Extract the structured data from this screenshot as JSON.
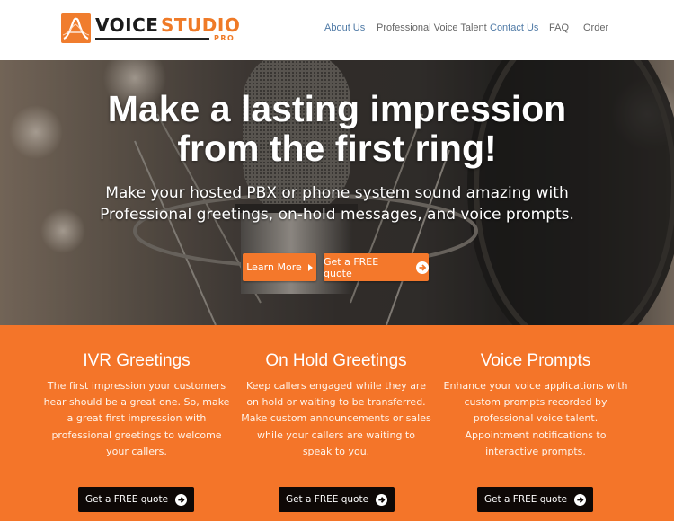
{
  "header": {
    "logo": {
      "word1": "VOICE",
      "word2": "STUDIO",
      "tagline": "PRO",
      "icon": "waveform-a-logo-icon"
    },
    "nav": [
      {
        "label": "About Us",
        "active": true
      },
      {
        "label": "Professional Voice Talent",
        "active": false
      },
      {
        "label": "Contact Us",
        "active": true
      },
      {
        "label": "FAQ",
        "active": false
      },
      {
        "label": "Order",
        "active": false
      }
    ]
  },
  "hero": {
    "title_line1": "Make a lasting impression",
    "title_line2": "from the first ring!",
    "subtitle_line1": "Make your hosted PBX or phone system sound amazing with",
    "subtitle_line2": "Professional greetings, on-hold messages, and voice prompts.",
    "buttons": [
      {
        "label": "Learn More",
        "icon": "caret-right-icon"
      },
      {
        "label": "Get a FREE quote",
        "icon": "arrow-circle-right-icon"
      }
    ],
    "background": "studio-microphone-photo"
  },
  "features": [
    {
      "title": "IVR Greetings",
      "lines": [
        "The first impression your customers",
        "hear should be a great one. So, make",
        "a great first impression with",
        "professional greetings to welcome",
        "your callers."
      ],
      "button": "Get a FREE quote"
    },
    {
      "title": "On Hold Greetings",
      "lines": [
        "Keep callers engaged while they are",
        "on hold or waiting to be transferred.",
        "Make custom announcements or sales",
        "while your callers are waiting to",
        "speak to you."
      ],
      "button": "Get a FREE quote"
    },
    {
      "title": "Voice Prompts",
      "lines": [
        "Enhance your voice applications with",
        "custom prompts recorded by",
        "professional voice talent.",
        "Appointment notifications to",
        "interactive prompts."
      ],
      "button": "Get a FREE quote"
    }
  ],
  "colors": {
    "brand_orange": "#f47529",
    "button_orange": "#f4782b",
    "button_black": "#0e0806",
    "nav_active": "#4f7aa6",
    "nav_default": "#666666"
  }
}
